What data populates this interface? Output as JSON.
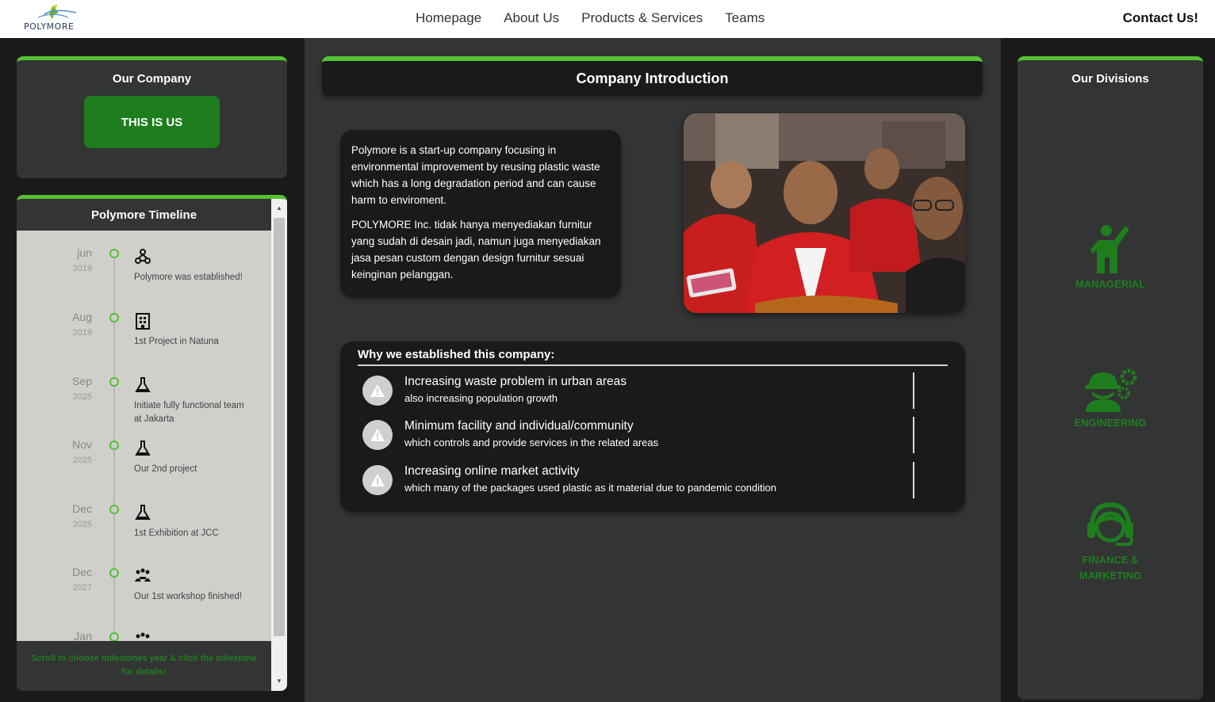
{
  "navbar": {
    "logo_text": "POLYMORE",
    "links": [
      "Homepage",
      "About Us",
      "Products & Services",
      "Teams"
    ],
    "contact": "Contact Us!"
  },
  "company": {
    "title": "Our Company",
    "button": "THIS IS US"
  },
  "timeline": {
    "title": "Polymore Timeline",
    "items": [
      {
        "month": "jun",
        "year": "2019",
        "icon": "network-icon",
        "text": "Polymore was established!"
      },
      {
        "month": "Aug",
        "year": "2019",
        "icon": "building-icon",
        "text": "1st Project in Natuna"
      },
      {
        "month": "Sep",
        "year": "2025",
        "icon": "flask-icon",
        "text": "Initiate fully functional team at Jakarta"
      },
      {
        "month": "Nov",
        "year": "2025",
        "icon": "flask-icon",
        "text": "Our 2nd project"
      },
      {
        "month": "Dec",
        "year": "2025",
        "icon": "flask-icon",
        "text": "1st Exhibition at JCC"
      },
      {
        "month": "Dec",
        "year": "2027",
        "icon": "people-icon",
        "text": "Our 1st workshop finished!"
      },
      {
        "month": "Jan",
        "year": "",
        "icon": "people-icon",
        "text": ""
      }
    ],
    "footer": "Scroll to choose milestones year & click the milestone for details!"
  },
  "intro": {
    "title": "Company Introduction",
    "paragraphs": [
      "Polymore is a start-up company focusing in environmental improvement by reusing plastic waste which has a long degradation period and can cause harm to enviroment.",
      "POLYMORE Inc. tidak hanya menyediakan furnitur yang sudah di desain jadi, namun juga menyediakan jasa pesan custom dengan design furnitur sesuai keinginan pelanggan."
    ],
    "photo_icon": "team-photo"
  },
  "why": {
    "title": "Why we established this company:",
    "reasons": [
      {
        "title": "Increasing waste problem in urban areas",
        "sub": "also increasing population growth"
      },
      {
        "title": "Minimum facility and individual/community",
        "sub": "which controls and provide services in the related areas"
      },
      {
        "title": "Increasing online market activity",
        "sub": "which many of the packages used plastic as it material due to pandemic condition"
      }
    ]
  },
  "divisions": {
    "title": "Our Divisions",
    "items": [
      {
        "label": "MANAGERIAL",
        "icon": "manager-icon"
      },
      {
        "label": "ENGINEERING",
        "icon": "engineer-icon"
      },
      {
        "label": "FINANCE & MARKETING",
        "icon": "headset-icon"
      }
    ]
  },
  "colors": {
    "accent": "#55c133",
    "button_green": "#1e7e1e",
    "panel_dark": "#1a1a1a",
    "panel_mid": "#333434",
    "timeline_bg": "#cfd0cc"
  }
}
